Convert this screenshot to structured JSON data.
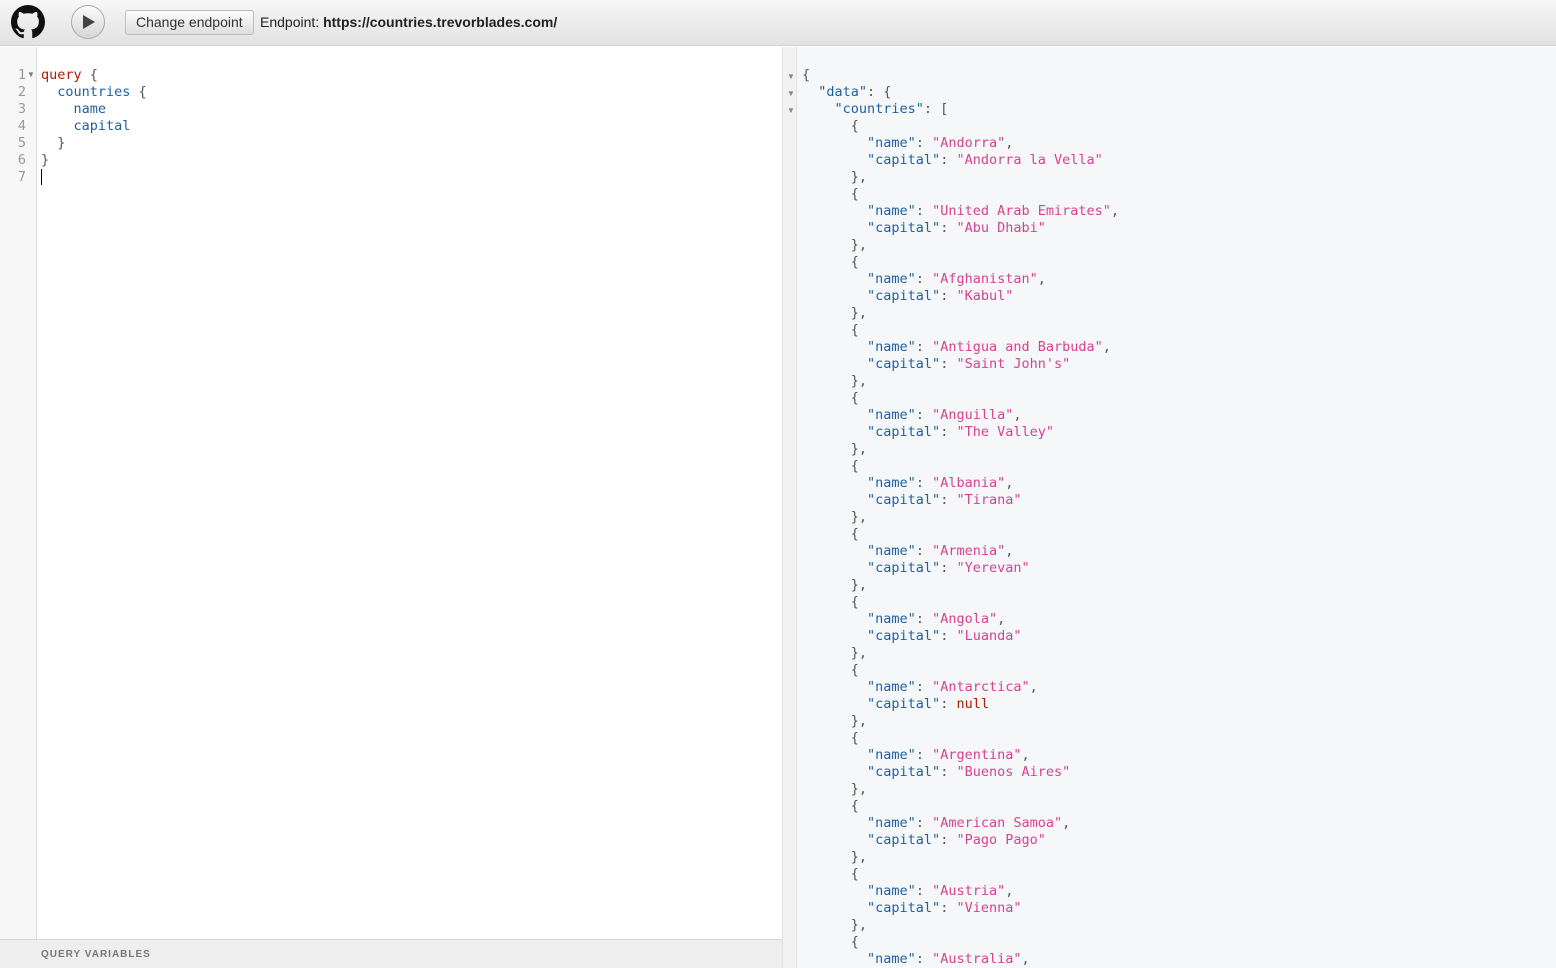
{
  "toolbar": {
    "run_label": "Execute query",
    "change_endpoint_label": "Change endpoint",
    "endpoint_prefix": "Endpoint: ",
    "endpoint_url": "https://countries.trevorblades.com/"
  },
  "query_editor": {
    "line_numbers": [
      "1",
      "2",
      "3",
      "4",
      "5",
      "6",
      "7"
    ],
    "keyword": "query",
    "field_root": "countries",
    "field_1": "name",
    "field_2": "capital"
  },
  "query_variables": {
    "title": "QUERY VARIABLES"
  },
  "result": {
    "root_key": "data",
    "list_key": "countries",
    "key_name": "name",
    "key_capital": "capital",
    "countries": [
      {
        "name": "Andorra",
        "capital": "Andorra la Vella"
      },
      {
        "name": "United Arab Emirates",
        "capital": "Abu Dhabi"
      },
      {
        "name": "Afghanistan",
        "capital": "Kabul"
      },
      {
        "name": "Antigua and Barbuda",
        "capital": "Saint John's"
      },
      {
        "name": "Anguilla",
        "capital": "The Valley"
      },
      {
        "name": "Albania",
        "capital": "Tirana"
      },
      {
        "name": "Armenia",
        "capital": "Yerevan"
      },
      {
        "name": "Angola",
        "capital": "Luanda"
      },
      {
        "name": "Antarctica",
        "capital": null
      },
      {
        "name": "Argentina",
        "capital": "Buenos Aires"
      },
      {
        "name": "American Samoa",
        "capital": "Pago Pago"
      },
      {
        "name": "Austria",
        "capital": "Vienna"
      },
      {
        "name": "Australia",
        "capital": ""
      }
    ]
  }
}
